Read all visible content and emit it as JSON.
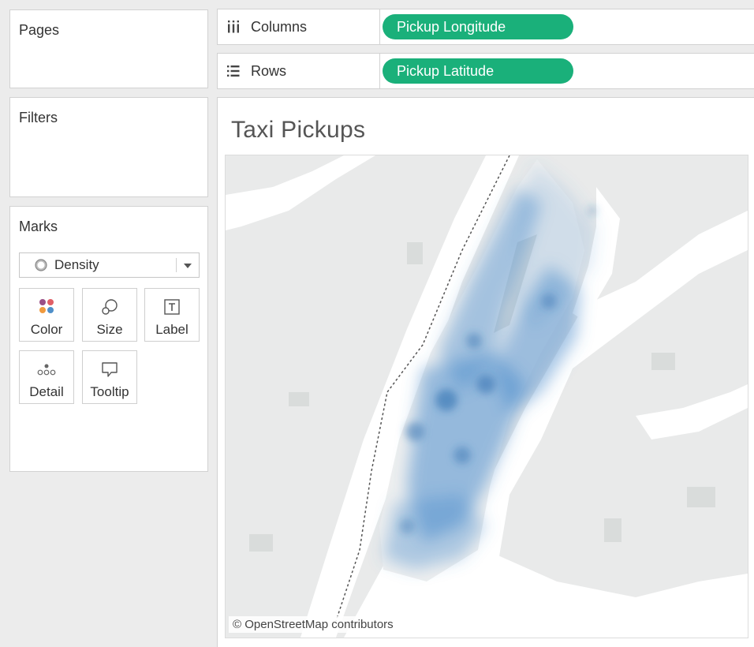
{
  "pages_card": {
    "title": "Pages"
  },
  "filters_card": {
    "title": "Filters"
  },
  "marks_card": {
    "title": "Marks",
    "mark_type": {
      "selected": "Density",
      "icon": "density-icon"
    },
    "buttons": {
      "color": {
        "label": "Color",
        "icon": "color-icon"
      },
      "size": {
        "label": "Size",
        "icon": "size-icon"
      },
      "label": {
        "label": "Label",
        "icon": "label-icon"
      },
      "detail": {
        "label": "Detail",
        "icon": "detail-icon"
      },
      "tooltip": {
        "label": "Tooltip",
        "icon": "tooltip-icon"
      }
    }
  },
  "shelves": {
    "columns": {
      "label": "Columns",
      "icon": "columns-icon",
      "pill": "Pickup Longitude"
    },
    "rows": {
      "label": "Rows",
      "icon": "rows-icon",
      "pill": "Pickup Latitude"
    }
  },
  "view": {
    "title": "Taxi Pickups",
    "attribution": "© OpenStreetMap contributors"
  },
  "colors": {
    "pill": "#1ab07a",
    "density": "#4a8ccc",
    "map_land": "#e9eaea",
    "map_water": "#ffffff",
    "map_park": "#d9dcdb"
  }
}
